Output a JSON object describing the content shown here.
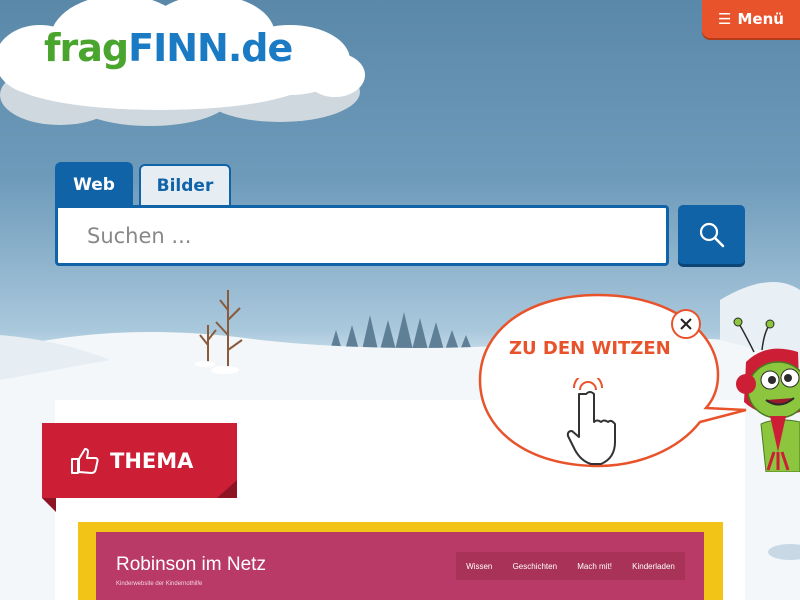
{
  "brand": {
    "part1": "frag",
    "part2": "FINN",
    "part3": ".de"
  },
  "menu": {
    "label": "Menü"
  },
  "search": {
    "tabs": [
      {
        "label": "Web",
        "active": true
      },
      {
        "label": "Bilder",
        "active": false
      }
    ],
    "placeholder": "Suchen ...",
    "value": ""
  },
  "promo": {
    "text": "ZU DEN WITZEN"
  },
  "thema": {
    "label": "THEMA"
  },
  "preview": {
    "title": "Robinson im Netz",
    "subtitle": "Kinderwebsite der Kindernothilfe",
    "nav": [
      "Wissen",
      "Geschichten",
      "Mach mit!",
      "Kinderladen"
    ]
  },
  "colors": {
    "primary": "#1163a8",
    "accent": "#e8532b",
    "thema": "#cc1f35",
    "logo_green": "#4aa52e",
    "preview_bg": "#b93a66",
    "preview_border": "#f2c418"
  }
}
